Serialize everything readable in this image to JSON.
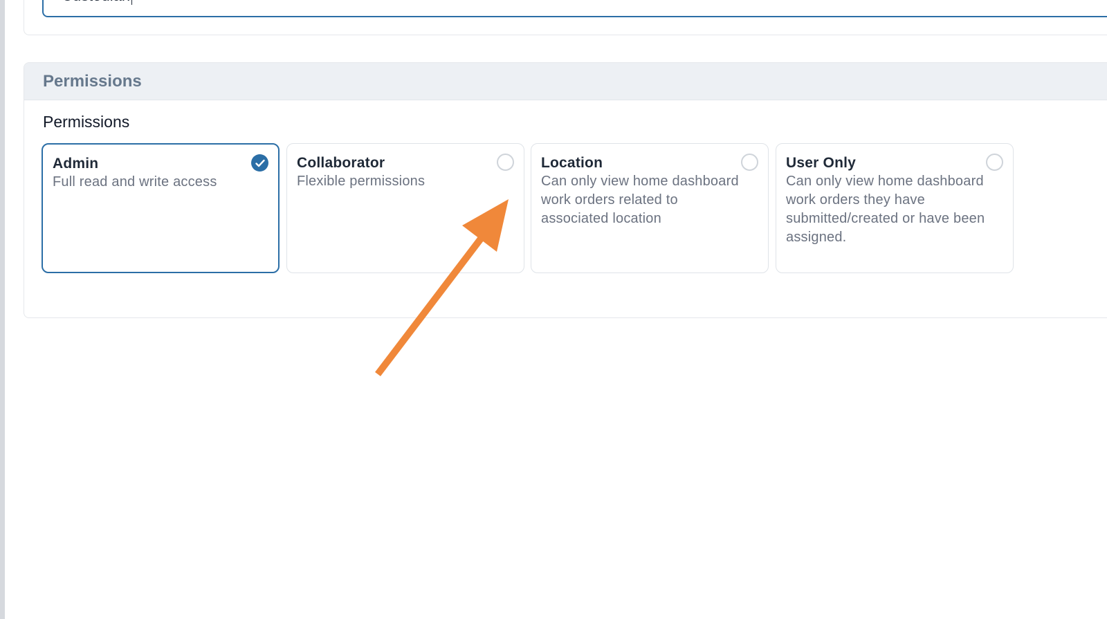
{
  "profile": {
    "name_value": "Custodian"
  },
  "permissions_section": {
    "header_title": "Permissions",
    "field_label": "Permissions",
    "options": [
      {
        "title": "Admin",
        "description": "Full read and write access",
        "selected": true
      },
      {
        "title": "Collaborator",
        "description": "Flexible permissions",
        "selected": false
      },
      {
        "title": "Location",
        "description": "Can only view home dashboard work orders related to associated location",
        "selected": false
      },
      {
        "title": "User Only",
        "description": "Can only view home dashboard work orders they have submitted/created or have been assigned.",
        "selected": false
      }
    ]
  },
  "colors": {
    "accent": "#2b6ea6",
    "annotation_arrow": "#f0883a",
    "header_bg": "#edf0f4"
  },
  "icons": {
    "selected_radio": "check-circle-icon",
    "unselected_radio": "radio-empty-icon",
    "annotation": "arrow-annotation-icon"
  }
}
